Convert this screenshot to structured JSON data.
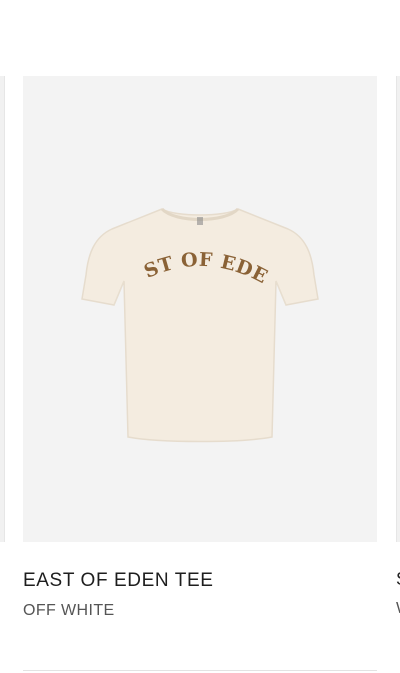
{
  "product": {
    "title": "EAST OF EDEN TEE",
    "color_name": "OFF WHITE",
    "print_text": "EAST OF EDEN",
    "image_icon": "tshirt-image",
    "shirt_color": "#f4ece0",
    "print_color": "#8a6236"
  },
  "next_product": {
    "title_initial": "S",
    "color_initial": "W"
  }
}
